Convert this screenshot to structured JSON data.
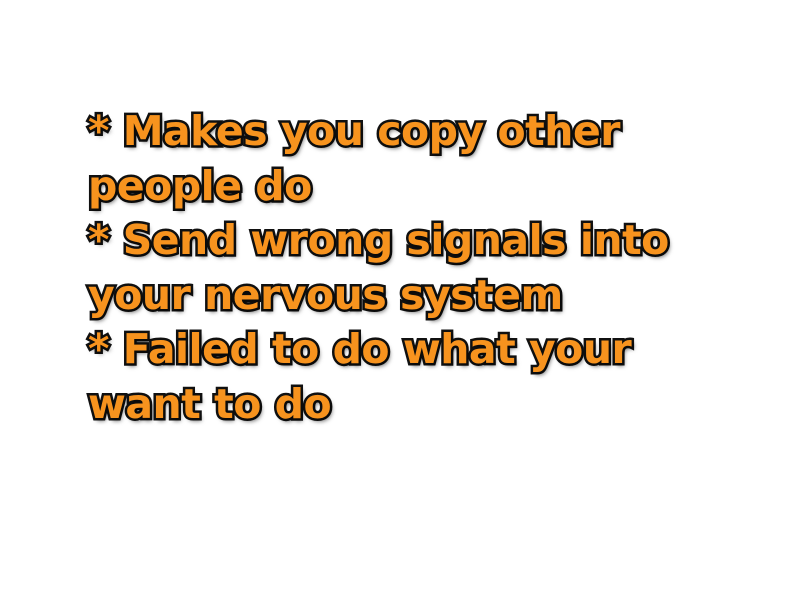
{
  "slide": {
    "lines": [
      "* Makes you copy other",
      "people do",
      "* Send wrong signals into",
      "your nervous system",
      "* Failed to do what your",
      "want to do"
    ]
  },
  "colors": {
    "background": "#ffffff",
    "text_fill": "#F7931E",
    "text_outline": "#111111"
  }
}
